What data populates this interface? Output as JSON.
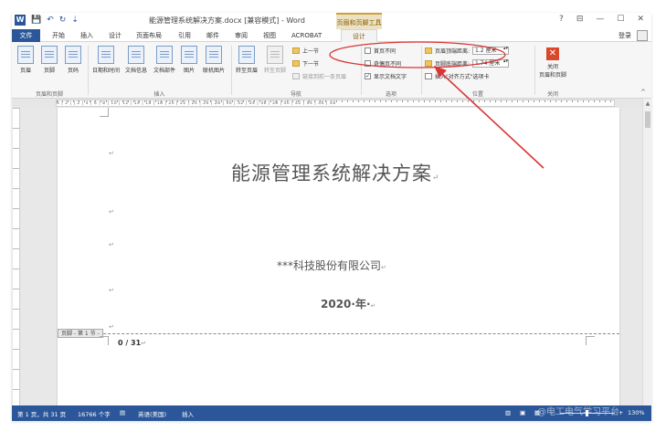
{
  "window": {
    "title": "能源管理系统解决方案.docx [兼容模式] - Word",
    "context_group": "页眉和页脚工具",
    "help": "?",
    "ribbon_options": "⊟",
    "minimize": "—",
    "maximize": "☐",
    "close": "✕",
    "login": "登录"
  },
  "qat": {
    "logo": "W",
    "save": "💾",
    "undo": "↶",
    "redo": "↻",
    "more": "⇣"
  },
  "tabs": [
    "文件",
    "开始",
    "插入",
    "设计",
    "页面布局",
    "引用",
    "邮件",
    "审阅",
    "视图",
    "ACROBAT",
    "设计"
  ],
  "ribbon": {
    "header_footer": {
      "label": "页眉和页脚",
      "buttons": [
        "页眉",
        "页脚",
        "页码"
      ]
    },
    "insert": {
      "label": "插入",
      "buttons": [
        "日期和时间",
        "文档信息",
        "文档部件",
        "图片",
        "联机图片"
      ]
    },
    "navigation": {
      "label": "导航",
      "buttons": [
        "转至页眉",
        "转至页脚"
      ],
      "small": [
        "上一节",
        "下一节",
        "链接到前一条页眉"
      ]
    },
    "options": {
      "label": "选项",
      "items": [
        {
          "label": "首页不同",
          "checked": false
        },
        {
          "label": "奇偶页不同",
          "checked": false
        },
        {
          "label": "显示文档文字",
          "checked": true
        }
      ],
      "check_mark": "✓"
    },
    "position": {
      "label": "位置",
      "header_from_top_label": "页眉顶端距离:",
      "header_from_top_value": "1.2 厘米",
      "footer_from_bottom_label": "页脚底端距离:",
      "footer_from_bottom_value": "1.74 厘米",
      "insert_align_tab": "插入\"对齐方式\"选项卡"
    },
    "close": {
      "label": "关闭",
      "button": "关闭\n页眉和页脚",
      "icon": "✕"
    },
    "collapse": "^"
  },
  "ruler": {
    "text": "4 | 2 |   | 2 | 4 | 6 | 8 | 10 | 12 | 14 | 16 | 18 | 20 | 22 | 24 | 26 | 28 | 30 | 32 | 34 | 36 | 38 | 40 | 42 | 44 | 46 | 48"
  },
  "document": {
    "para_mark": "↵",
    "title": "能源管理系统解决方案",
    "title_mark": "↵",
    "company": "***科技股份有限公司",
    "company_mark": "↵",
    "year": "2020·年·",
    "year_mark": "↵",
    "footer_tag": "页脚 - 第 1 节 -",
    "page_number": "0 / 31",
    "page_number_mark": "↵"
  },
  "statusbar": {
    "pages": "第 1 页，共 31 页",
    "words": "16766 个字",
    "language": "英语(美国)",
    "mode": "插入",
    "zoom": "130%",
    "zoom_out": "-",
    "zoom_in": "+",
    "watermark": "@电工电气学习平台"
  },
  "annotation": {
    "color": "#d93636"
  }
}
